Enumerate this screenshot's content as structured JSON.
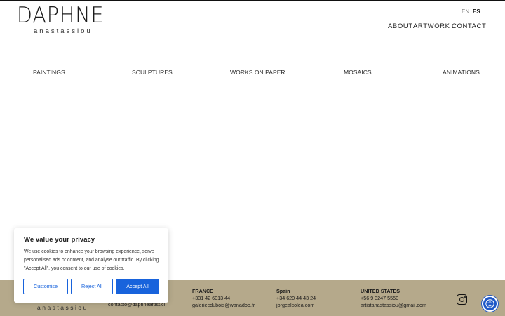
{
  "header": {
    "logo_main": "DAPHNE",
    "logo_sub": "anastassiou",
    "languages": [
      "EN",
      "ES"
    ],
    "nav": {
      "about": "ABOUT",
      "artwork": "ARTWORK",
      "contact": "CONTACT"
    }
  },
  "categories": [
    "PAINTINGS",
    "SCULPTURES",
    "WORKS ON PAPER",
    "MOSAICS",
    "ANIMATIONS"
  ],
  "footer": {
    "logo_sub": "anastassiou",
    "chile": {
      "email": "contacto@daphneartist.cl"
    },
    "france": {
      "heading": "FRANCE",
      "phone": "+331 42 6013 44",
      "email": "galeriecdubois@wanadoo.fr"
    },
    "spain": {
      "heading": "Spain",
      "phone": "+34 620 44 43 24",
      "email": "jorgealcolea.com"
    },
    "usa": {
      "heading": "UNITED STATES",
      "phone": "+56 9 3247 5550",
      "email": "artistanastassiou@gmail.com"
    },
    "instagram_icon": "instagram-icon"
  },
  "cookie_banner": {
    "title": "We value your privacy",
    "text": "We use cookies to enhance your browsing experience, serve personalised ads or content, and analyse our traffic. By clicking \"Accept All\", you consent to our use of cookies.",
    "customise_label": "Customise",
    "reject_label": "Reject All",
    "accept_label": "Accept All"
  },
  "colors": {
    "footer_bg": "#b5a98b",
    "accent_blue": "#1863dc",
    "accessibility_blue": "#1f58c7"
  },
  "accessibility_icon": "accessibility-icon"
}
